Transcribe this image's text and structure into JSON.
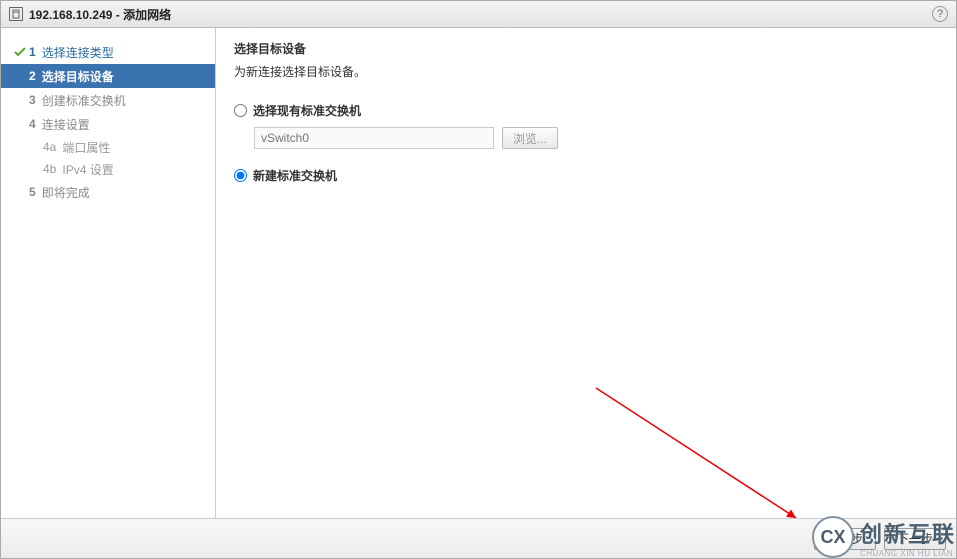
{
  "titlebar": {
    "ip": "192.168.10.249",
    "action": "添加网络",
    "help": "?"
  },
  "steps": {
    "s1": {
      "num": "1",
      "label": "选择连接类型"
    },
    "s2": {
      "num": "2",
      "label": "选择目标设备"
    },
    "s3": {
      "num": "3",
      "label": "创建标准交换机"
    },
    "s4": {
      "num": "4",
      "label": "连接设置"
    },
    "s4a": {
      "num": "4a",
      "label": "端口属性"
    },
    "s4b": {
      "num": "4b",
      "label": "IPv4 设置"
    },
    "s5": {
      "num": "5",
      "label": "即将完成"
    }
  },
  "content": {
    "heading": "选择目标设备",
    "desc": "为新连接选择目标设备。",
    "radio_existing": "选择现有标准交换机",
    "switch_placeholder": "vSwitch0",
    "browse": "浏览...",
    "radio_new": "新建标准交换机"
  },
  "footer": {
    "prev": "上一步",
    "next": "下一步"
  },
  "watermark": {
    "logo": "CX",
    "big": "创新互联",
    "small": "CHUANG XIN HU LIAN"
  }
}
